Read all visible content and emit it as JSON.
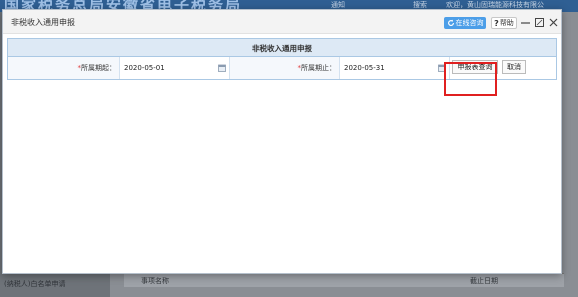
{
  "background": {
    "header_title": "国家税务总局安徽省电子税务局",
    "header_right_items": [
      "通知",
      "搜索",
      "欢迎，黄山固瑞能源科技有限公"
    ],
    "sidebar_item": "(纳税人)白名单申请",
    "table_columns": [
      "事项名称",
      "截止日期"
    ]
  },
  "dialog": {
    "title": "非税收入通用申报",
    "online_consult_label": "在线咨询",
    "help_label": "帮助",
    "help_symbol": "?"
  },
  "form": {
    "header": "非税收入通用申报",
    "period_start_label": "所属期起：",
    "period_start_value": "2020-05-01",
    "period_end_label": "所属期止：",
    "period_end_value": "2020-05-31",
    "required_mark": "*",
    "query_button_label": "申报表查询",
    "cancel_button_label": "取消"
  },
  "colors": {
    "accent": "#4c9ee8",
    "form_header_bg": "#dde9f5",
    "highlight": "#e02020",
    "required": "#e03a3a"
  },
  "icons": [
    "refresh-icon",
    "help-icon",
    "minimize-icon",
    "maximize-icon",
    "close-icon",
    "calendar-icon"
  ]
}
